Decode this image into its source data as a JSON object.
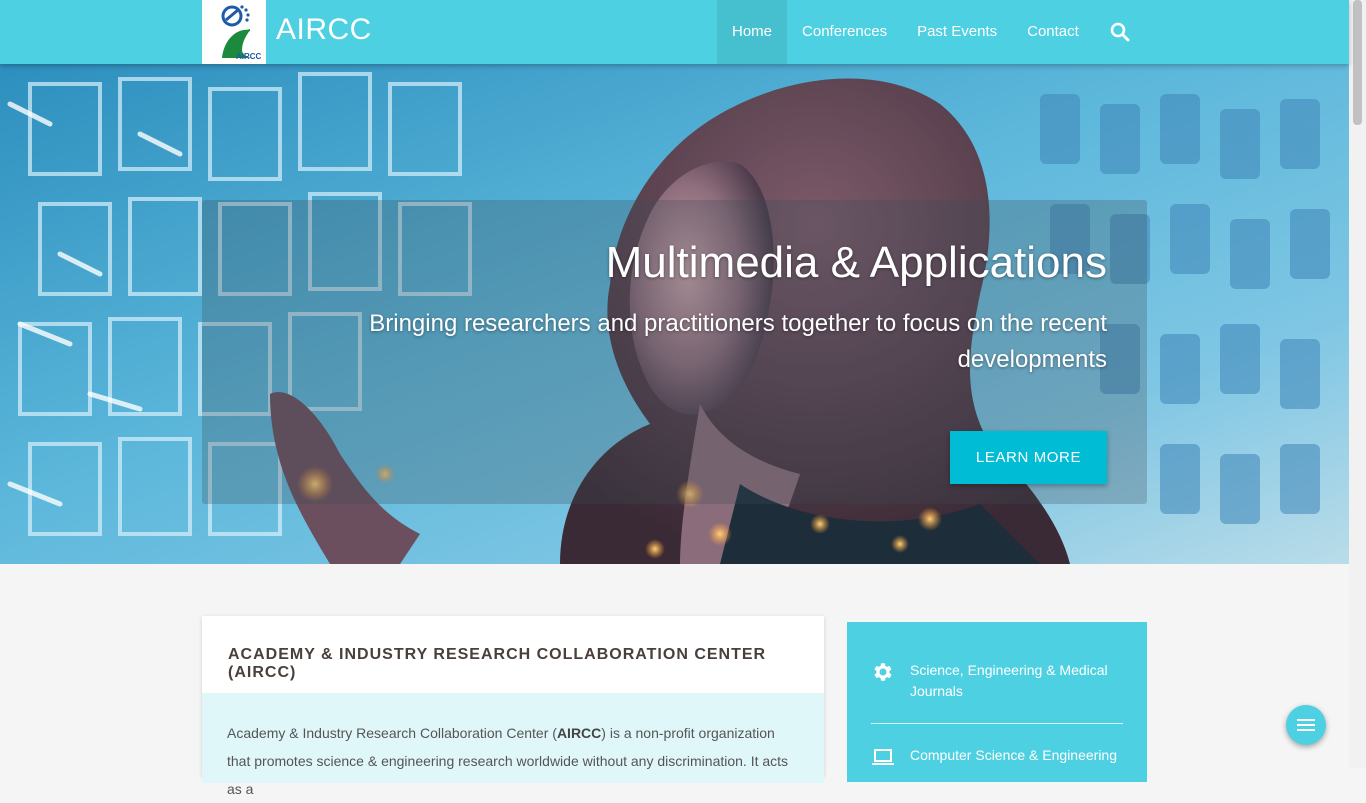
{
  "header": {
    "brand": "AIRCC",
    "logo_text": "AIRCC",
    "nav": [
      {
        "label": "Home",
        "active": true
      },
      {
        "label": "Conferences",
        "active": false
      },
      {
        "label": "Past Events",
        "active": false
      },
      {
        "label": "Contact",
        "active": false
      }
    ],
    "search_icon": "search-icon"
  },
  "hero": {
    "title": "Multimedia & Applications",
    "subtitle": "Bringing researchers and practitioners together to focus on the recent developments",
    "button": "LEARN MORE"
  },
  "main_card": {
    "title": "ACADEMY & INDUSTRY RESEARCH COLLABORATION CENTER (AIRCC)",
    "text_before": "Academy & Industry Research Collaboration Center (",
    "text_bold": "AIRCC",
    "text_after": ") is a non-profit organization that promotes science & engineering research worldwide without any discrimination. It acts as a"
  },
  "side_card": {
    "items": [
      {
        "icon": "gear-icon",
        "label": "Science, Engineering & Medical Journals"
      },
      {
        "icon": "laptop-icon",
        "label": "Computer Science & Engineering"
      }
    ]
  },
  "fab_icon": "menu-icon",
  "colors": {
    "primary": "#4dd0e1",
    "button": "#00bcd4",
    "card_body": "#e0f7fa",
    "background": "#f5f5f5"
  }
}
